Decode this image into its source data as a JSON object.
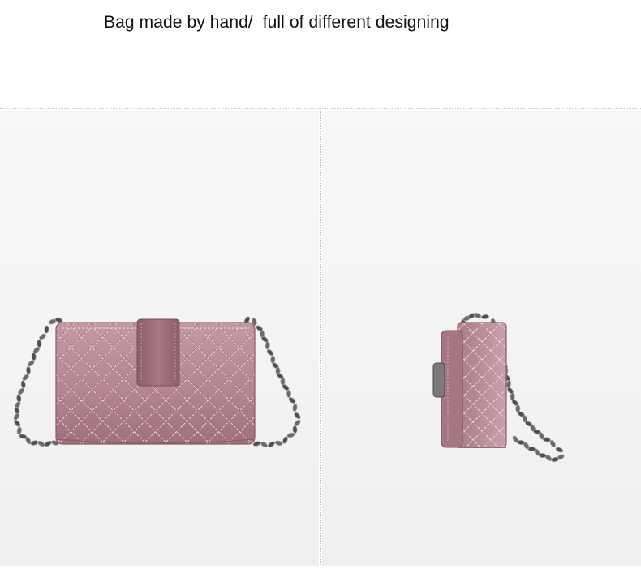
{
  "caption": "Bag made by hand/  full of different designing",
  "colors": {
    "background": "#ffffff",
    "panel": "#f4f4f4",
    "leather": "#b58591",
    "leather_dark": "#8e5f6b",
    "stitch": "#e9d6db",
    "chain": "#5a5a5a",
    "chain_highlight": "#a8a8a8"
  },
  "images": [
    {
      "name": "front view",
      "subject": "quilted pink crossbody bag with chain strap"
    },
    {
      "name": "side view",
      "subject": "quilted pink crossbody bag with chain strap"
    }
  ]
}
